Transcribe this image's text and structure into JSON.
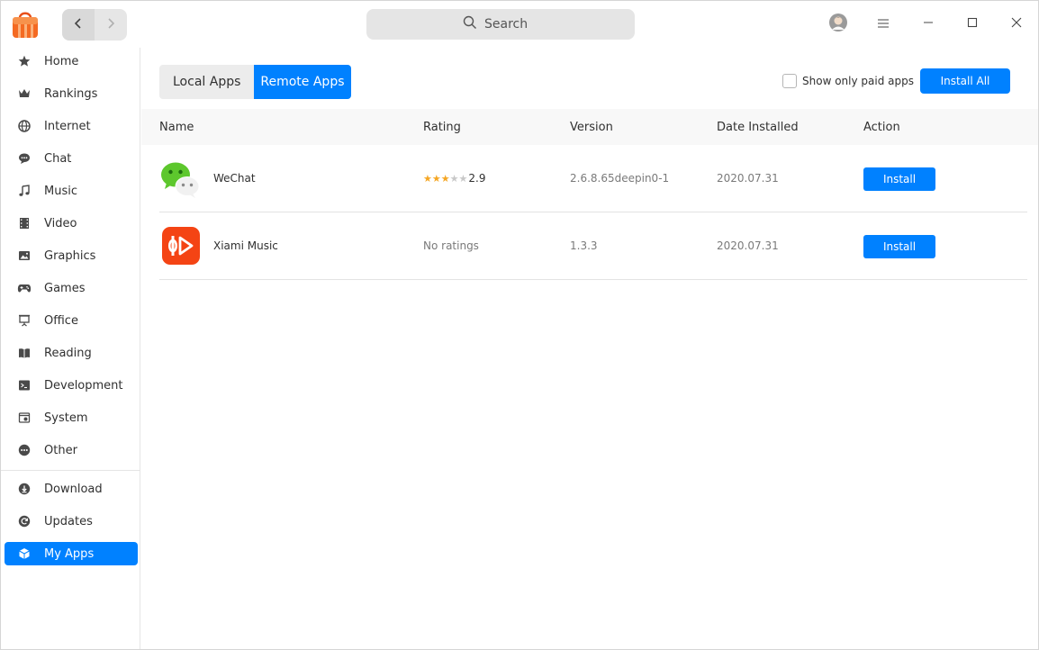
{
  "titlebar": {
    "search_placeholder": "Search",
    "icons": [
      "app-store-logo",
      "back-arrow-icon",
      "forward-arrow-icon",
      "search-icon",
      "user-avatar",
      "menu-icon",
      "minimize-icon",
      "maximize-icon",
      "close-icon"
    ]
  },
  "sidebar": {
    "items": [
      {
        "label": "Home",
        "icon": "star-icon"
      },
      {
        "label": "Rankings",
        "icon": "crown-icon"
      },
      {
        "label": "Internet",
        "icon": "globe-icon"
      },
      {
        "label": "Chat",
        "icon": "chat-bubble-icon"
      },
      {
        "label": "Music",
        "icon": "music-note-icon"
      },
      {
        "label": "Video",
        "icon": "film-icon"
      },
      {
        "label": "Graphics",
        "icon": "image-icon"
      },
      {
        "label": "Games",
        "icon": "gamepad-icon"
      },
      {
        "label": "Office",
        "icon": "presentation-icon"
      },
      {
        "label": "Reading",
        "icon": "book-icon"
      },
      {
        "label": "Development",
        "icon": "terminal-icon"
      },
      {
        "label": "System",
        "icon": "system-window-icon"
      },
      {
        "label": "Other",
        "icon": "more-dots-icon"
      }
    ],
    "bottom_items": [
      {
        "label": "Download",
        "icon": "download-icon"
      },
      {
        "label": "Updates",
        "icon": "refresh-icon"
      },
      {
        "label": "My Apps",
        "icon": "cube-icon",
        "active": true
      }
    ],
    "active_color": "#0081ff"
  },
  "main": {
    "tabs": [
      {
        "label": "Local Apps",
        "active": false
      },
      {
        "label": "Remote Apps",
        "active": true
      }
    ],
    "paid_filter_label": "Show only paid apps",
    "paid_filter_checked": false,
    "install_all_label": "Install All",
    "columns": [
      "Name",
      "Rating",
      "Version",
      "Date Installed",
      "Action"
    ],
    "apps": [
      {
        "name": "WeChat",
        "icon": "wechat-icon",
        "rating": "2.9",
        "rating_stars": 2.9,
        "version": "2.6.8.65deepin0-1",
        "date_installed": "2020.07.31",
        "action": "Install"
      },
      {
        "name": "Xiami Music",
        "icon": "xiami-music-icon",
        "rating": "No ratings",
        "rating_stars": null,
        "version": "1.3.3",
        "date_installed": "2020.07.31",
        "action": "Install"
      }
    ]
  },
  "colors": {
    "accent": "#0081ff",
    "star_filled": "#f5a623",
    "star_empty": "#c8c8c8",
    "wechat_green": "#5dc72d",
    "xiami_orange": "#f44414"
  }
}
